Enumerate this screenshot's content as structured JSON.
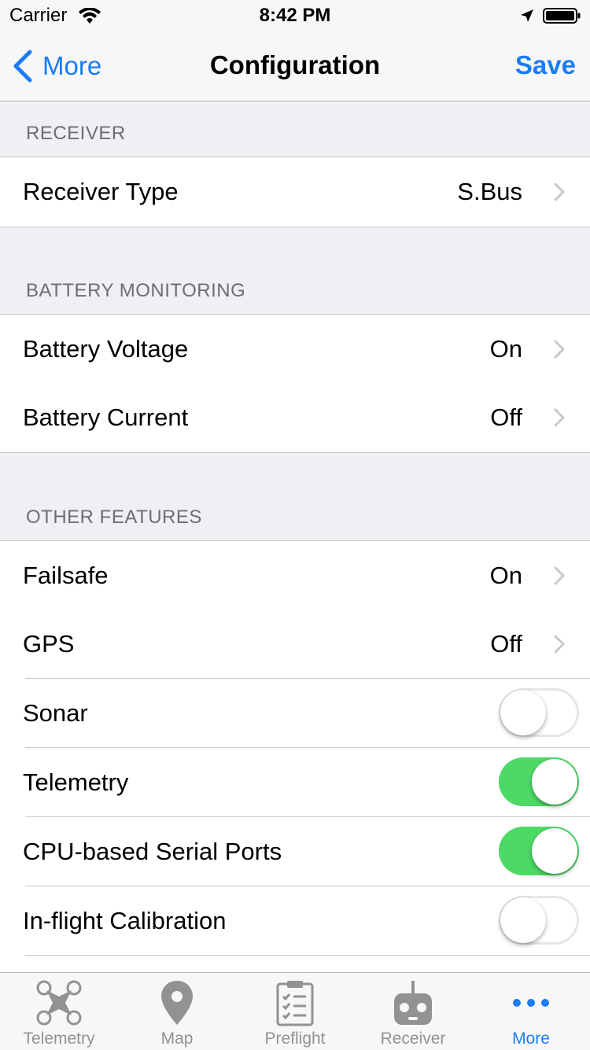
{
  "status_bar": {
    "carrier": "Carrier",
    "time": "8:42 PM"
  },
  "nav": {
    "back_label": "More",
    "title": "Configuration",
    "save_label": "Save"
  },
  "sections": {
    "receiver": {
      "header": "RECEIVER",
      "rows": [
        {
          "label": "Receiver Type",
          "value": "S.Bus"
        }
      ]
    },
    "battery": {
      "header": "BATTERY MONITORING",
      "rows": [
        {
          "label": "Battery Voltage",
          "value": "On"
        },
        {
          "label": "Battery Current",
          "value": "Off"
        }
      ]
    },
    "other": {
      "header": "OTHER FEATURES",
      "rows": [
        {
          "label": "Failsafe",
          "value": "On"
        },
        {
          "label": "GPS",
          "value": "Off"
        },
        {
          "label": "Sonar",
          "toggle": false
        },
        {
          "label": "Telemetry",
          "toggle": true
        },
        {
          "label": "CPU-based Serial Ports",
          "toggle": true
        },
        {
          "label": "In-flight Calibration",
          "toggle": false
        }
      ]
    }
  },
  "tabbar": {
    "tabs": [
      {
        "label": "Telemetry",
        "icon": "quadcopter-icon"
      },
      {
        "label": "Map",
        "icon": "map-pin-icon"
      },
      {
        "label": "Preflight",
        "icon": "clipboard-checklist-icon"
      },
      {
        "label": "Receiver",
        "icon": "rc-transmitter-icon"
      },
      {
        "label": "More",
        "icon": "more-dots-icon",
        "active": true
      }
    ]
  },
  "colors": {
    "accent": "#1a7cf6",
    "toggle_on": "#4cd964",
    "background": "#efeff4"
  }
}
